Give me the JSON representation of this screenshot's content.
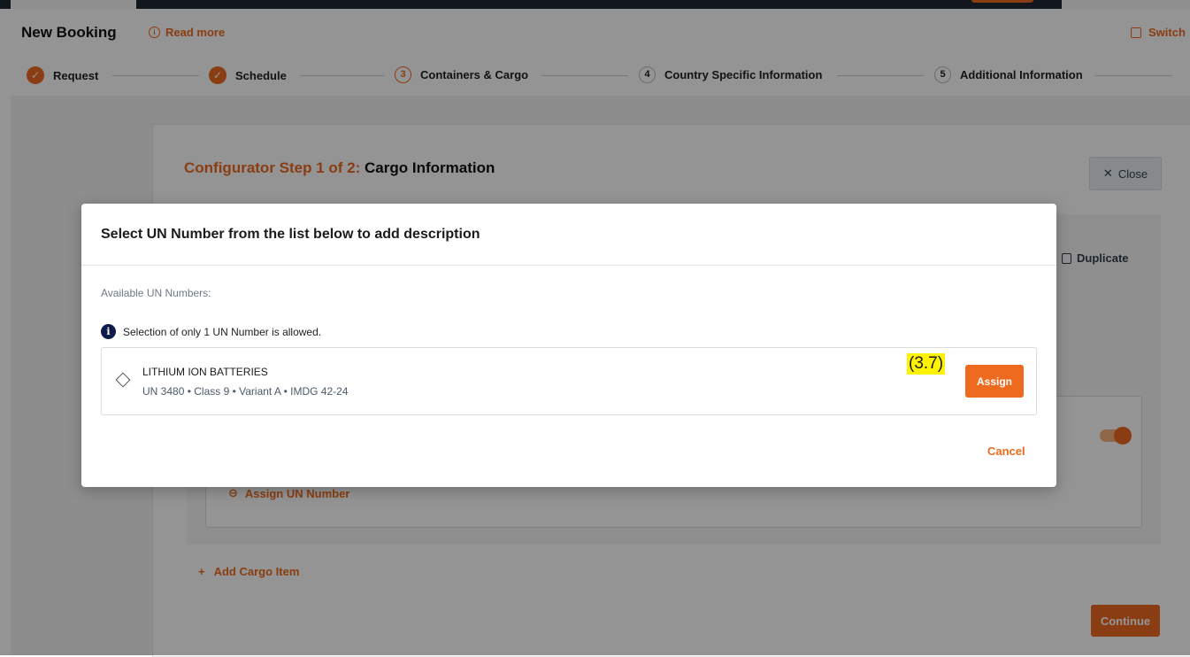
{
  "header": {
    "title": "New Booking",
    "read_more": "Read more",
    "switch": "Switch"
  },
  "stepper": {
    "steps": [
      {
        "label": "Request",
        "state": "done"
      },
      {
        "label": "Schedule",
        "state": "done"
      },
      {
        "number": "3",
        "label": "Containers & Cargo",
        "state": "active"
      },
      {
        "number": "4",
        "label": "Country Specific Information",
        "state": "pending"
      },
      {
        "number": "5",
        "label": "Additional Information",
        "state": "pending"
      }
    ]
  },
  "configurator": {
    "title_prefix": "Configurator Step 1 of 2:",
    "title_main": "Cargo Information",
    "close_label": "Close",
    "duplicate_label": "Duplicate",
    "assign_un_number": "Assign UN Number",
    "add_cargo_item": "Add Cargo Item",
    "continue_label": "Continue"
  },
  "modal": {
    "title": "Select UN Number from the list below to add description",
    "available_label": "Available UN Numbers:",
    "notice": "Selection of only 1 UN Number is allowed.",
    "items": [
      {
        "name": "LITHIUM ION BATTERIES",
        "details": "UN 3480 • Class 9 • Variant A • IMDG 42-24",
        "value": "(3.7)",
        "assign_label": "Assign"
      }
    ],
    "cancel_label": "Cancel"
  },
  "colors": {
    "accent": "#ee6a1f",
    "navy": "#0d1b4c",
    "highlight": "#fff200"
  }
}
